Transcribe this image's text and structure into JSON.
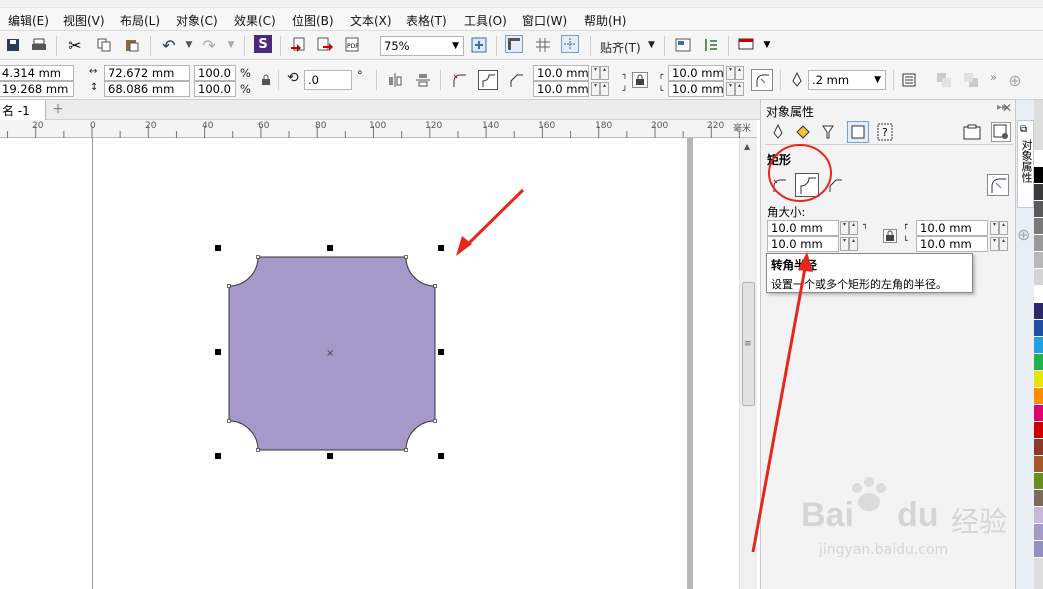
{
  "menu": [
    "编辑(E)",
    "视图(V)",
    "布局(L)",
    "对象(C)",
    "效果(C)",
    "位图(B)",
    "文本(X)",
    "表格(T)",
    "工具(O)",
    "窗口(W)",
    "帮助(H)"
  ],
  "toolbar": {
    "zoom": "75%",
    "snap_label": "贴齐(T)"
  },
  "property_bar": {
    "x": "4.314 mm",
    "y": "19.268 mm",
    "width": "72.672 mm",
    "height": "68.086 mm",
    "scale_x": "100.0",
    "scale_y": "100.0",
    "percent": "%",
    "rotation": ".0",
    "degree": "°",
    "corner_tl": "10.0 mm",
    "corner_bl": "10.0 mm",
    "corner_tr": "10.0 mm",
    "corner_br": "10.0 mm",
    "outline_width": ".2 mm"
  },
  "document_tab": "名 -1",
  "ruler": {
    "ticks": [
      "20",
      "0",
      "20",
      "40",
      "60",
      "80",
      "100",
      "120",
      "140",
      "160",
      "180",
      "200",
      "220"
    ],
    "unit": "毫米"
  },
  "shape": {
    "fill": "#a599c9",
    "corner_type": "scalloped"
  },
  "panel": {
    "title": "对象属性",
    "section": "矩形",
    "corner_size_label": "角大小:",
    "corner_tl": "10.0 mm",
    "corner_bl": "10.0 mm",
    "corner_tr": "10.0 mm",
    "corner_br": "10.0 mm",
    "tooltip_title": "转角半径",
    "tooltip_text": "设置一个或多个矩形的左角的半径。",
    "side_tab": "对象属性"
  },
  "watermark": {
    "brand": "Bai",
    "brand2": "du",
    "cn": "经验",
    "url": "jingyan.baidu.com"
  },
  "colors": {
    "annotation_red": "#e8261f",
    "palette": [
      "#ffffff",
      "#000000",
      "#3a3a3a",
      "#5a5a5a",
      "#7a7a7a",
      "#9a9a9a",
      "#b8b8b8",
      "#d4d4d4",
      "#ffffff",
      "#2a2a6a",
      "#1e4fa0",
      "#1fa0e0",
      "#22b14c",
      "#e6e600",
      "#ff8c00",
      "#e0006e",
      "#d10000",
      "#8b3a2a",
      "#a05a2c",
      "#6b8e23",
      "#7d6b5a",
      "#c8b8d8",
      "#a599c9",
      "#9090c0"
    ]
  }
}
